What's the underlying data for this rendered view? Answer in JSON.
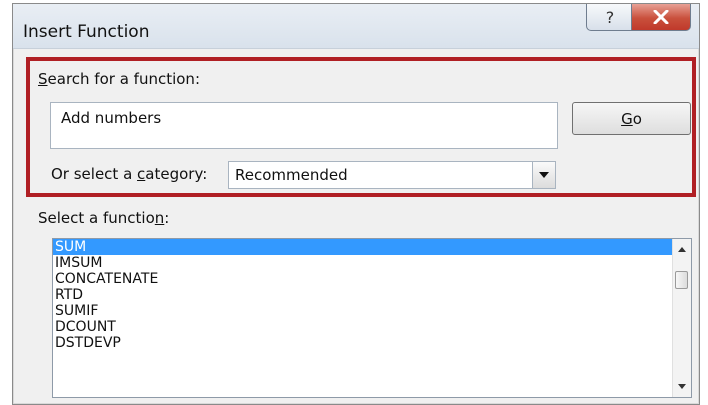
{
  "dialog": {
    "title": "Insert Function",
    "help_glyph": "?",
    "close_glyph": "X"
  },
  "search": {
    "label_prefix": "",
    "label_mnemonic": "S",
    "label_rest": "earch for a function:",
    "value": "Add numbers",
    "go_label_mnemonic": "G",
    "go_label_rest": "o"
  },
  "category": {
    "label_prefix": "Or select a ",
    "label_mnemonic": "c",
    "label_rest": "ategory:",
    "selected": "Recommended"
  },
  "functions": {
    "label_prefix": "Select a functio",
    "label_mnemonic": "n",
    "label_rest": ":",
    "items": [
      "SUM",
      "IMSUM",
      "CONCATENATE",
      "RTD",
      "SUMIF",
      "DCOUNT",
      "DSTDEVP"
    ],
    "selected_index": 0
  },
  "colors": {
    "highlight": "#b01f24",
    "selection": "#3399ff"
  }
}
